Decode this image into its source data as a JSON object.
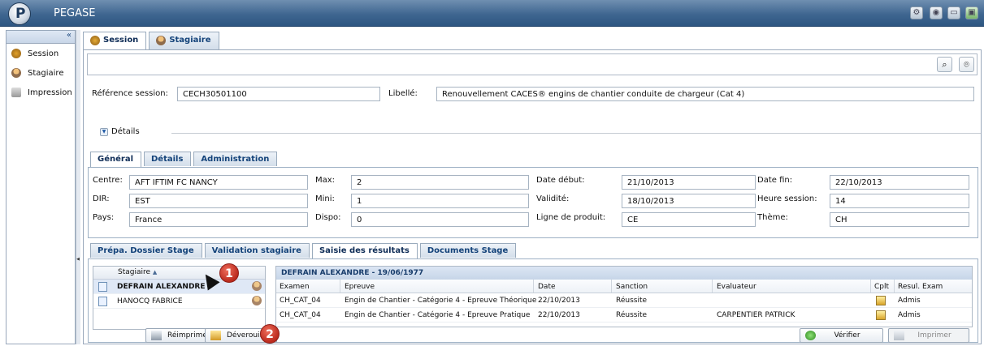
{
  "app": {
    "title": "PEGASE",
    "header_icons": [
      "wrench-icon",
      "settings-icon",
      "message-icon",
      "exit-icon"
    ]
  },
  "sidebar": {
    "collapse_label": "«",
    "items": [
      {
        "label": "Session",
        "icon": "session-icon"
      },
      {
        "label": "Stagiaire",
        "icon": "person-icon"
      },
      {
        "label": "Impression",
        "icon": "printer-icon"
      }
    ]
  },
  "tabs": [
    {
      "label": "Session"
    },
    {
      "label": "Stagiaire"
    }
  ],
  "session": {
    "reference_label": "Référence session:",
    "reference_value": "CECH30501100",
    "libelle_label": "Libellé:",
    "libelle_value": "Renouvellement CACES® engins de chantier conduite de chargeur (Cat 4)",
    "details_label": "Détails"
  },
  "subtabs": [
    {
      "label": "Général"
    },
    {
      "label": "Détails"
    },
    {
      "label": "Administration"
    }
  ],
  "general": {
    "centre_label": "Centre:",
    "centre_value": "AFT IFTIM FC NANCY",
    "dir_label": "DIR:",
    "dir_value": "EST",
    "pays_label": "Pays:",
    "pays_value": "France",
    "max_label": "Max:",
    "max_value": "2",
    "mini_label": "Mini:",
    "mini_value": "1",
    "dispo_label": "Dispo:",
    "dispo_value": "0",
    "date_debut_label": "Date début:",
    "date_debut_value": "21/10/2013",
    "validite_label": "Validité:",
    "validite_value": "18/10/2013",
    "ligne_label": "Ligne de produit:",
    "ligne_value": "CE",
    "date_fin_label": "Date fin:",
    "date_fin_value": "22/10/2013",
    "heure_label": "Heure session:",
    "heure_value": "14",
    "theme_label": "Thème:",
    "theme_value": "CH"
  },
  "result_tabs": [
    {
      "label": "Prépa. Dossier Stage"
    },
    {
      "label": "Validation stagiaire"
    },
    {
      "label": "Saisie des résultats"
    },
    {
      "label": "Documents Stage"
    }
  ],
  "stagiaires": {
    "header": "Stagiaire",
    "rows": [
      {
        "name": "DEFRAIN ALEXANDRE"
      },
      {
        "name": "HANOCQ FABRICE"
      }
    ]
  },
  "results": {
    "title": "DEFRAIN ALEXANDRE - 19/06/1977",
    "headers": [
      "Examen",
      "Epreuve",
      "Date",
      "Sanction",
      "Evaluateur",
      "Cplt",
      "Resul. Exam"
    ],
    "rows": [
      [
        "CH_CAT_04",
        "Engin de Chantier - Catégorie 4 - Epreuve Théorique",
        "22/10/2013",
        "Réussite",
        "",
        "",
        "Admis"
      ],
      [
        "CH_CAT_04",
        "Engin de Chantier - Catégorie 4 - Epreuve Pratique",
        "22/10/2013",
        "Réussite",
        "CARPENTIER PATRICK",
        "",
        "Admis"
      ]
    ]
  },
  "buttons": {
    "reimprimer": "Réimprimer",
    "deverrouiller": "Déverouiller",
    "verifier": "Vérifier",
    "imprimer": "Imprimer"
  },
  "annotations": {
    "one": "1",
    "two": "2"
  }
}
